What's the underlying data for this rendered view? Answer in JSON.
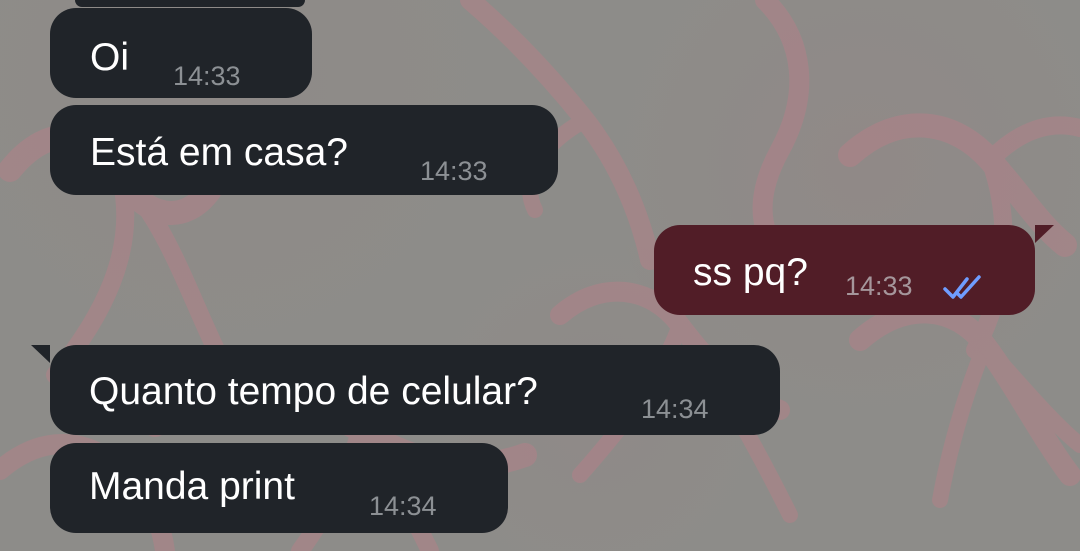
{
  "chat": {
    "messages": [
      {
        "direction": "incoming",
        "text": "Oi",
        "time": "14:33"
      },
      {
        "direction": "incoming",
        "text": "Está em casa?",
        "time": "14:33"
      },
      {
        "direction": "outgoing",
        "text": "ss pq?",
        "time": "14:33",
        "status_icon": "double-check-icon"
      },
      {
        "direction": "incoming",
        "text": "Quanto tempo de celular?",
        "time": "14:34"
      },
      {
        "direction": "incoming",
        "text": "Manda print",
        "time": "14:34"
      }
    ]
  },
  "colors": {
    "background": "#8d8c89",
    "incoming_bubble": "#202429",
    "outgoing_bubble": "#511d27",
    "message_text": "#ffffff",
    "incoming_time": "#8c9094",
    "outgoing_time": "#a5969b",
    "read_ticks": "#6f9dff",
    "ribbon_pattern": "#c87b88"
  },
  "icons": [
    "double-check-icon",
    "ribbon-wallpaper-pattern"
  ]
}
